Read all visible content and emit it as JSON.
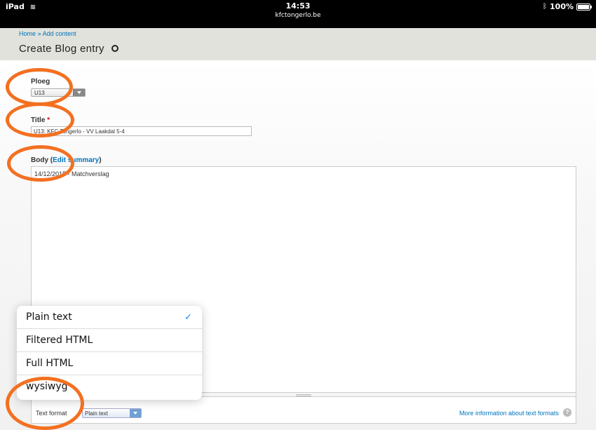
{
  "status_bar": {
    "device": "iPad",
    "time": "14:53",
    "url": "kfctongerlo.be",
    "battery": "100%"
  },
  "header": {
    "breadcrumb": [
      "Home",
      "Add content"
    ],
    "breadcrumb_sep": "»",
    "title": "Create Blog entry"
  },
  "form": {
    "ploeg": {
      "label": "Ploeg",
      "value": "U13"
    },
    "title": {
      "label": "Title",
      "required_mark": "*",
      "value": "U13: KFC Tongerlo - VV Laakdal 5-4"
    },
    "body": {
      "label": "Body",
      "edit_summary": "Edit summary",
      "value": "14/12/2015 - Matchverslag"
    },
    "text_format": {
      "label": "Text format",
      "value": "Plain text",
      "more_info": "More information about text formats",
      "help": "?"
    }
  },
  "popover": {
    "options": [
      {
        "label": "Plain text",
        "checked": true
      },
      {
        "label": "Filtered HTML",
        "checked": false
      },
      {
        "label": "Full HTML",
        "checked": false
      },
      {
        "label": "wysiwyg",
        "checked": false
      }
    ],
    "check_glyph": "✓"
  },
  "colors": {
    "link": "#0074bd",
    "highlight": "#f37021",
    "header_bg": "#e1e2dc",
    "check": "#1a82fb"
  }
}
